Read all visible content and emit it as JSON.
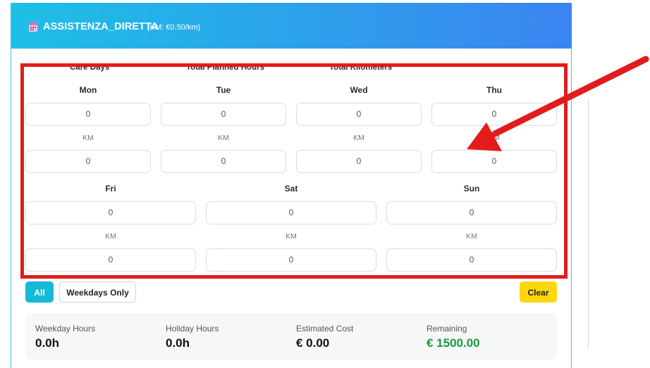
{
  "header": {
    "title": "ASSISTENZA_DIRETTA",
    "rate": "(KM: €0.50/km)",
    "icon": "calendar-icon"
  },
  "summary_labels": {
    "care_days": "Care Days",
    "total_hours": "Total Planned Hours",
    "total_km": "Total Kilometers"
  },
  "days": [
    {
      "name": "Mon",
      "hours": "0",
      "km_label": "KM",
      "km": "0"
    },
    {
      "name": "Tue",
      "hours": "0",
      "km_label": "KM",
      "km": "0"
    },
    {
      "name": "Wed",
      "hours": "0",
      "km_label": "KM",
      "km": "0"
    },
    {
      "name": "Thu",
      "hours": "0",
      "km_label": "KM",
      "km": "0"
    },
    {
      "name": "Fri",
      "hours": "0",
      "km_label": "KM",
      "km": "0"
    },
    {
      "name": "Sat",
      "hours": "0",
      "km_label": "KM",
      "km": "0"
    },
    {
      "name": "Sun",
      "hours": "0",
      "km_label": "KM",
      "km": "0"
    }
  ],
  "buttons": {
    "all": "All",
    "weekdays_only": "Weekdays Only",
    "clear": "Clear"
  },
  "stats": {
    "weekday_hours_label": "Weekday Hours",
    "weekday_hours_value": "0.0h",
    "holiday_hours_label": "Holiday Hours",
    "holiday_hours_value": "0.0h",
    "estimated_cost_label": "Estimated Cost",
    "estimated_cost_value": "€ 0.00",
    "remaining_label": "Remaining",
    "remaining_value": "€ 1500.00"
  },
  "colors": {
    "header_start": "#1dc0e6",
    "header_end": "#3b84f0",
    "highlight_annotation": "#e21c1c",
    "remaining_green": "#1a9a38",
    "clear_yellow": "#fdd60e",
    "all_cyan": "#16b9d7"
  }
}
